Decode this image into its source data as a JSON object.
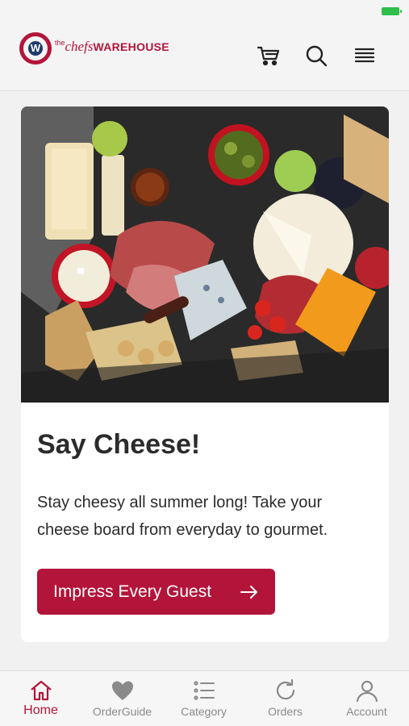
{
  "app": {
    "brand": {
      "the": "the",
      "chefs": "chefs",
      "warehouse": "WAREHOUSE",
      "mark": "W"
    },
    "accent_color": "#b3153a"
  },
  "header": {
    "icons": [
      "cart-icon",
      "search-icon",
      "menu-icon"
    ]
  },
  "promo": {
    "image_alt": "cheese-and-charcuterie-board",
    "title": "Say Cheese!",
    "body": "Stay cheesy all summer long! Take your cheese board from everyday to gourmet.",
    "cta_label": "Impress Every Guest",
    "cta_icon": "arrow-right-icon"
  },
  "tabbar": {
    "items": [
      {
        "label": "Home",
        "icon": "home-icon",
        "active": true
      },
      {
        "label": "OrderGuide",
        "icon": "heart-icon",
        "active": false
      },
      {
        "label": "Category",
        "icon": "list-icon",
        "active": false
      },
      {
        "label": "Orders",
        "icon": "refresh-icon",
        "active": false
      },
      {
        "label": "Account",
        "icon": "user-icon",
        "active": false
      }
    ]
  }
}
